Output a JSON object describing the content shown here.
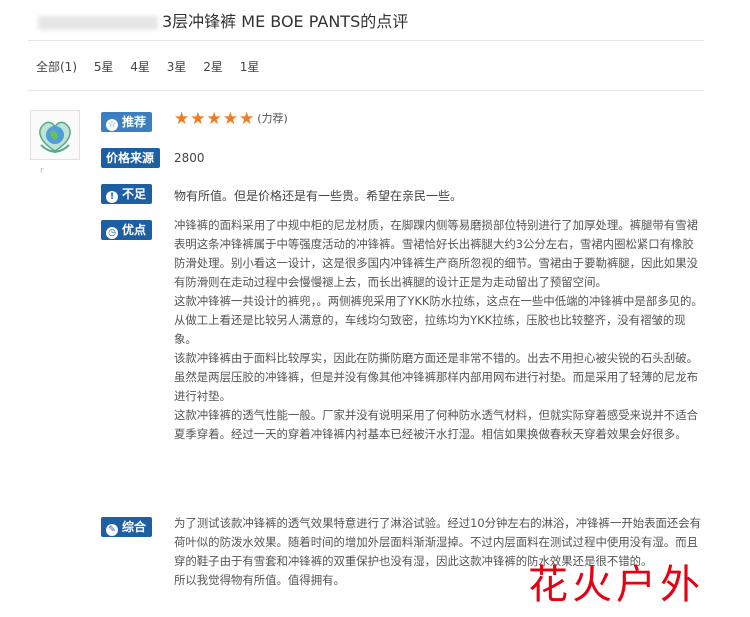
{
  "page": {
    "title": "3层冲锋裤 ME BOE PANTS的点评"
  },
  "filters": [
    {
      "label": "全部(1)"
    },
    {
      "label": "5星"
    },
    {
      "label": "4星"
    },
    {
      "label": "3星"
    },
    {
      "label": "2星"
    },
    {
      "label": "1星"
    }
  ],
  "review": {
    "user_name": "r",
    "recommend": {
      "label": "推荐",
      "rating": 5,
      "stars": "★★★★★",
      "note": "(力荐)"
    },
    "price_source": {
      "label": "价格来源",
      "value": "2800"
    },
    "cons": {
      "label": "不足",
      "text": "物有所值。但是价格还是有一些贵。希望在亲民一些。"
    },
    "pros": {
      "label": "优点",
      "paragraphs": [
        "冲锋裤的面料采用了中规中柜的尼龙材质，在脚踝内侧等易磨损部位特别进行了加厚处理。裤腿带有雪裙表明这条冲锋裤属于中等强度活动的冲锋裤。雪裙恰好长出裤腿大约3公分左右，雪裙内圈松紧口有橡胶防滑处理。别小看这一设计，这是很多国内冲锋裤生产商所忽视的细节。雪裙由于要勒裤腿，因此如果没有防滑则在走动过程中会慢慢褪上去，而长出裤腿的设计正是为走动留出了预留空间。",
        "这款冲锋裤一共设计的裤兜，。两侧裤兜采用了YKK防水拉练，这点在一些中低端的冲锋裤中是部多见的。从做工上看还是比较另人满意的，车线均匀致密，拉练均为YKK拉练，压胶也比较整齐，没有褶皱的现象。",
        "该款冲锋裤由于面料比较厚实，因此在防撕防磨方面还是非常不错的。出去不用担心被尖锐的石头刮破。虽然是两层压胶的冲锋裤，但是并没有像其他冲锋裤那样内部用网布进行衬垫。而是采用了轻薄的尼龙布进行衬垫。",
        "这款冲锋裤的透气性能一般。厂家并没有说明采用了何种防水透气材料，但就实际穿着感受来说并不适合夏季穿着。经过一天的穿着冲锋裤内衬基本已经被汗水打湿。相信如果换做春秋天穿着效果会好很多。"
      ]
    },
    "summary": {
      "label": "综合",
      "paragraphs": [
        "为了测试该款冲锋裤的透气效果特意进行了淋浴试验。经过10分钟左右的淋浴，冲锋裤一开始表面还会有荷叶似的防泼水效果。随着时间的增加外层面料渐渐湿掉。不过内层面料在测试过程中使用没有湿。而且穿的鞋子由于有雪套和冲锋裤的双重保护也没有湿，因此这款冲锋裤的防水效果还是很不错的。",
        "所以我觉得物有所值。值得拥有。"
      ]
    }
  },
  "watermark": "花火户外",
  "colors": {
    "badge_blue": "#3b7fc0",
    "badge_dark": "#1d5fa3",
    "star_orange": "#f07c1f",
    "watermark_red": "#e50012"
  }
}
